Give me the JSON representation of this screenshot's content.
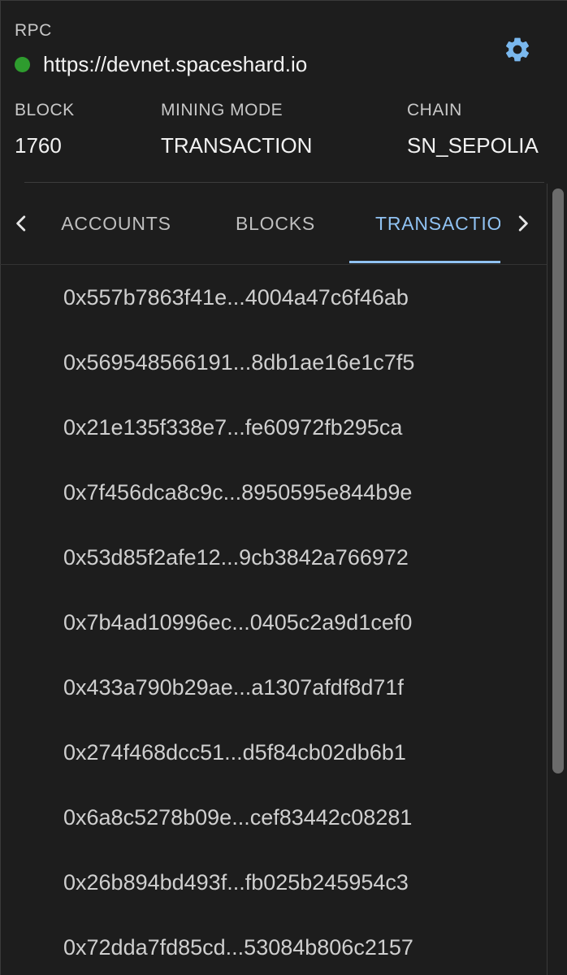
{
  "rpc": {
    "label": "RPC",
    "url": "https://devnet.spaceshard.io",
    "status_color": "#2e9c2e"
  },
  "settings_icon": "gear-icon",
  "stats": {
    "block": {
      "label": "BLOCK",
      "value": "1760"
    },
    "mining_mode": {
      "label": "MINING MODE",
      "value": "TRANSACTION"
    },
    "chain": {
      "label": "CHAIN",
      "value": "SN_SEPOLIA"
    }
  },
  "tabs": {
    "items": [
      {
        "label": "ACCOUNTS",
        "active": false
      },
      {
        "label": "BLOCKS",
        "active": false
      },
      {
        "label": "TRANSACTIONS",
        "active": true
      }
    ],
    "prev_icon": "chevron-left-icon",
    "next_icon": "chevron-right-icon",
    "active_color": "#90c2f2"
  },
  "transactions": [
    "0x557b7863f41e...4004a47c6f46ab",
    "0x569548566191...8db1ae16e1c7f5",
    "0x21e135f338e7...fe60972fb295ca",
    "0x7f456dca8c9c...8950595e844b9e",
    "0x53d85f2afe12...9cb3842a766972",
    "0x7b4ad10996ec...0405c2a9d1cef0",
    "0x433a790b29ae...a1307afdf8d71f",
    "0x274f468dcc51...d5f84cb02db6b1",
    "0x6a8c5278b09e...cef83442c08281",
    "0x26b894bd493f...fb025b245954c3",
    "0x72dda7fd85cd...53084b806c2157"
  ],
  "colors": {
    "background": "#1d1d1d",
    "accent": "#90c2f2",
    "settings_icon": "#7ab8ee"
  }
}
